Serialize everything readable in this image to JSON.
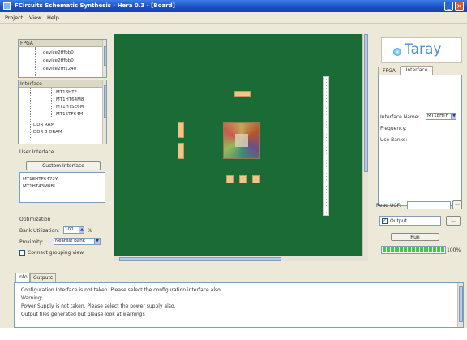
{
  "window": {
    "title": "FCircuits Schematic Synthesis - Hera 0.3 - [Board]",
    "minimize": "_",
    "close": "×"
  },
  "menu": [
    "Project",
    "View",
    "Help"
  ],
  "fpga_tree": {
    "header": "FPGA",
    "items": [
      "device2fffbb0",
      "device2fffbb0",
      "device2fff1240"
    ]
  },
  "interface_tree": {
    "header": "Interface",
    "items": [
      "MT18HTF...",
      "MT1HT64M8",
      "MT1HTSE6M",
      "MT16TF64M"
    ],
    "groups": [
      "DDR RAM",
      "DDR 3 DRAM"
    ]
  },
  "user_interface": {
    "label": "User Interface",
    "button": "Custom Interface",
    "items": [
      "MT18HTF6472Y",
      "MT1HT43M0BL"
    ]
  },
  "optimization": {
    "label": "Optimization",
    "bank_utilization_label": "Bank Utilization:",
    "bank_utilization_value": "100",
    "bank_utilization_unit": "%",
    "proximity_label": "Proximity:",
    "proximity_value": "Nearest Bank",
    "connect_grouping_label": "Connect grouping view",
    "connect_grouping_checked": false
  },
  "right_panel": {
    "logo": "Taray",
    "tabs": [
      "FPGA",
      "Interface"
    ],
    "active_tab": 1,
    "interface_name_label": "Interface Name:",
    "interface_name_value": "MT18HTF",
    "frequency_label": "Frequency:",
    "use_banks_label": "Use Banks:",
    "read_ucf_label": "Read UCF:",
    "browse_label": "...",
    "output_checkbox_label": "Output",
    "output_checked": true,
    "run_label": "Run",
    "progress_percent": 100,
    "progress_text": "100%"
  },
  "bottom_tabs": [
    "Info",
    "Outputs"
  ],
  "console_lines": [
    "Configuration Interface is not taken. Please select the configuration interface also.",
    "Warning:",
    "Power Supply is not taken. Please select the power supply also.",
    "Output files generated but please look at warnings"
  ],
  "colors": {
    "canvas": "#1b6b37",
    "progress": "#3ecf3e",
    "titlebar": "#1b4fc4",
    "logo": "#4a8fd0"
  }
}
